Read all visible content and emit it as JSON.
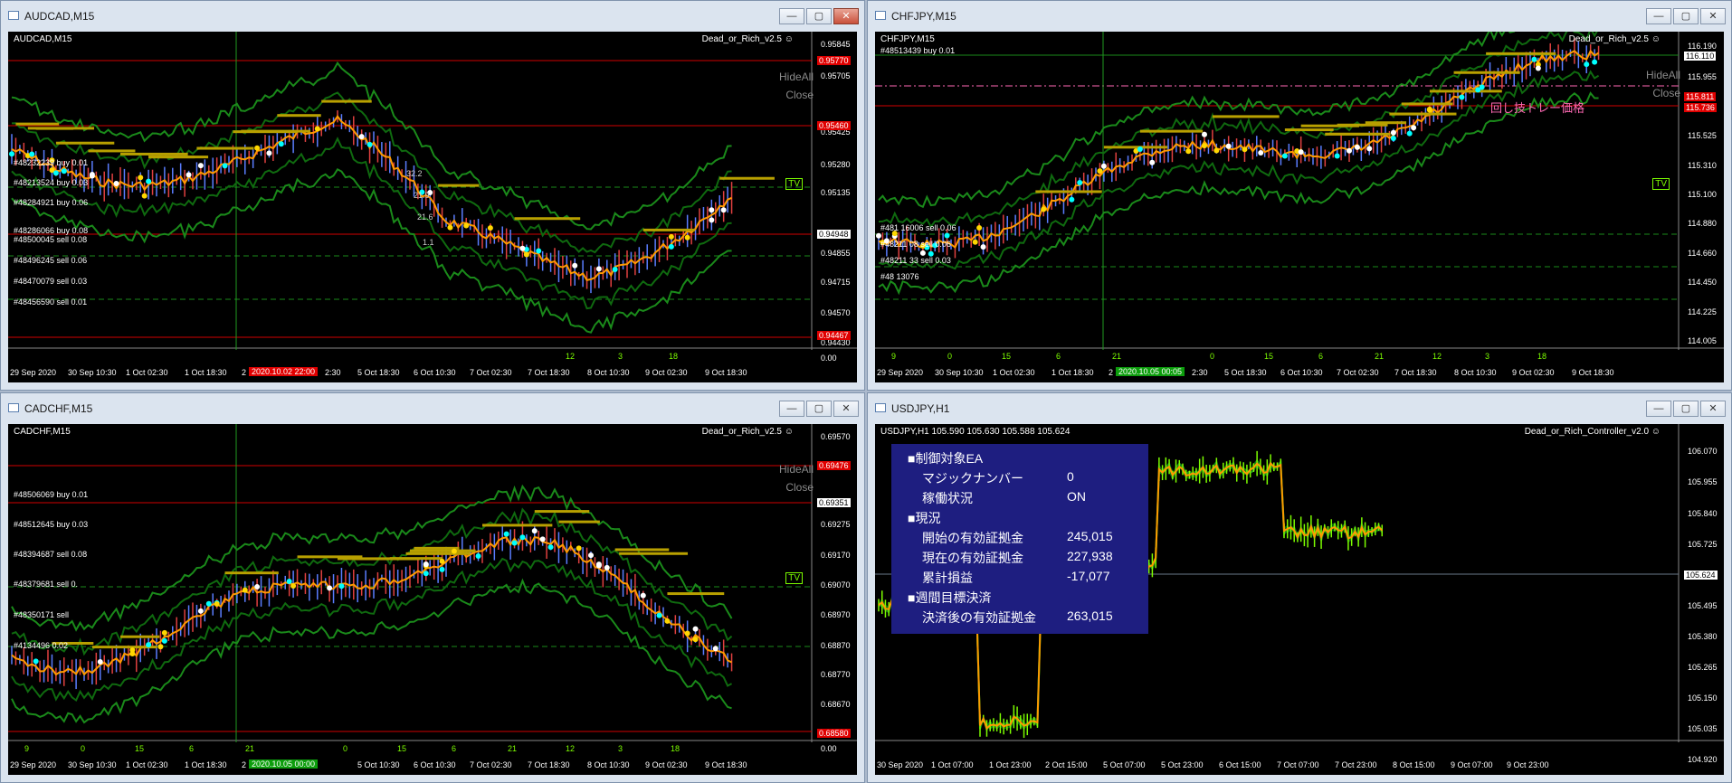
{
  "windows": [
    {
      "id": "audcad",
      "title": "AUDCAD,M15",
      "chart_label": "AUDCAD,M15",
      "indicator": "Dead_or_Rich_v2.5 ☺",
      "hide_all": "HideAll",
      "close_btn": "Close",
      "tv": "TV",
      "annotations": [
        "32.2",
        "21.9",
        "21.6",
        "1.1"
      ],
      "orders": [
        "#48232239 buy 0.01",
        "#48213524 buy 0.03",
        "#48284921 buy 0.06",
        "#48286066 buy 0.08",
        "#48500045 sell 0.08",
        "#48496245 sell 0.06",
        "#48470079 sell 0.03",
        "#48456590 sell 0.01"
      ],
      "price_labels": [
        "0.95845",
        "0.95705",
        "0.95425",
        "0.95280",
        "0.95135",
        "0.94855",
        "0.94715",
        "0.94570",
        "0.94430",
        "0.00"
      ],
      "price_boxes": [
        "0.95770",
        "0.95460",
        "0.94948",
        "0.94467"
      ],
      "time_labels": [
        "29 Sep 2020",
        "30 Sep 10:30",
        "1 Oct 02:30",
        "1 Oct 18:30",
        "2",
        "2:30",
        "5 Oct 18:30",
        "6 Oct 10:30",
        "7 Oct 02:30",
        "7 Oct 18:30",
        "8 Oct 10:30",
        "9 Oct 02:30",
        "9 Oct 18:30"
      ],
      "time_highlight": "2020.10.02 22:00",
      "sub_labels": [
        "12",
        "3",
        "18"
      ]
    },
    {
      "id": "chfjpy",
      "title": "CHFJPY,M15",
      "chart_label": "CHFJPY,M15",
      "chart_sublabel": "#48513439 buy 0.01",
      "indicator": "Dead_or_Rich_v2.5 ☺",
      "hide_all": "HideAll",
      "close_btn": "Close",
      "tv": "TV",
      "jp_label": "回し技トレー価格",
      "orders": [
        "#481 16006 sell 0.06",
        "#48211 08 sell 0.06",
        "#48211 33 sell 0.03",
        "#48 13076"
      ],
      "price_labels": [
        "116.190",
        "115.955",
        "115.525",
        "115.310",
        "115.100",
        "114.880",
        "114.660",
        "114.450",
        "114.225",
        "114.005"
      ],
      "price_boxes": [
        "116.110",
        "115.811",
        "115.736"
      ],
      "time_labels": [
        "29 Sep 2020",
        "30 Sep 10:30",
        "1 Oct 02:30",
        "1 Oct 18:30",
        "2",
        "2:30",
        "5 Oct 18:30",
        "6 Oct 10:30",
        "7 Oct 02:30",
        "7 Oct 18:30",
        "8 Oct 10:30",
        "9 Oct 02:30",
        "9 Oct 18:30"
      ],
      "time_highlight": "2020.10.05 00:05",
      "sub_labels": [
        "9",
        "0",
        "15",
        "6",
        "21",
        "0",
        "15",
        "6",
        "21",
        "12",
        "3",
        "18"
      ]
    },
    {
      "id": "cadchf",
      "title": "CADCHF,M15",
      "chart_label": "CADCHF,M15",
      "indicator": "Dead_or_Rich_v2.5 ☺",
      "hide_all": "HideAll",
      "close_btn": "Close",
      "tv": "TV",
      "orders": [
        "#48506069 buy 0.01",
        "#48512645 buy 0.03",
        "#48394687 sell 0.08",
        "#48379681 sell 0.",
        "#48350171 sell",
        "#4134496 0.02"
      ],
      "price_labels": [
        "0.69570",
        "0.69275",
        "0.69170",
        "0.69070",
        "0.68970",
        "0.68870",
        "0.68770",
        "0.68670",
        "0.00"
      ],
      "price_boxes": [
        "0.69476",
        "0.69351",
        "0.68580"
      ],
      "time_labels": [
        "29 Sep 2020",
        "30 Sep 10:30",
        "1 Oct 02:30",
        "1 Oct 18:30",
        "2",
        "5 Oct 10:30",
        "6 Oct 10:30",
        "7 Oct 02:30",
        "7 Oct 18:30",
        "8 Oct 10:30",
        "9 Oct 02:30",
        "9 Oct 18:30"
      ],
      "time_highlight": "2020.10.05 00:00",
      "sub_labels": [
        "9",
        "0",
        "15",
        "6",
        "21",
        "0",
        "15",
        "6",
        "21",
        "12",
        "3",
        "18"
      ]
    },
    {
      "id": "usdjpy",
      "title": "USDJPY,H1",
      "chart_label": "USDJPY,H1  105.590 105.630 105.588 105.624",
      "indicator": "Dead_or_Rich_Controller_v2.0 ☺",
      "price_labels": [
        "106.070",
        "105.955",
        "105.840",
        "105.725",
        "105.495",
        "105.380",
        "105.265",
        "105.150",
        "105.035",
        "104.920"
      ],
      "price_boxes": [
        "105.624"
      ],
      "time_labels": [
        "30 Sep 2020",
        "1 Oct 07:00",
        "1 Oct 23:00",
        "2 Oct 15:00",
        "5 Oct 07:00",
        "5 Oct 23:00",
        "6 Oct 15:00",
        "7 Oct 07:00",
        "7 Oct 23:00",
        "8 Oct 15:00",
        "9 Oct 07:00",
        "9 Oct 23:00"
      ],
      "panel": {
        "rows": [
          {
            "label": "■制御対象EA",
            "value": ""
          },
          {
            "label": "マジックナンバー",
            "value": "0"
          },
          {
            "label": "稼働状況",
            "value": "ON"
          },
          {
            "label": "■現況",
            "value": ""
          },
          {
            "label": "開始の有効証拠金",
            "value": "245,015"
          },
          {
            "label": "現在の有効証拠金",
            "value": "227,938"
          },
          {
            "label": "累計損益",
            "value": "-17,077"
          },
          {
            "label": "■週間目標決済",
            "value": ""
          },
          {
            "label": "決済後の有効証拠金",
            "value": "263,015"
          }
        ]
      }
    }
  ],
  "window_buttons": {
    "minimize": "—",
    "maximize": "▢",
    "close": "✕"
  },
  "colors": {
    "bg": "#000000",
    "price_red": "#e00000",
    "band_green": "#1f7a1f",
    "candle_green": "#7cfc00",
    "ma_orange": "#ff9a00",
    "panel": "#1e1e80"
  }
}
